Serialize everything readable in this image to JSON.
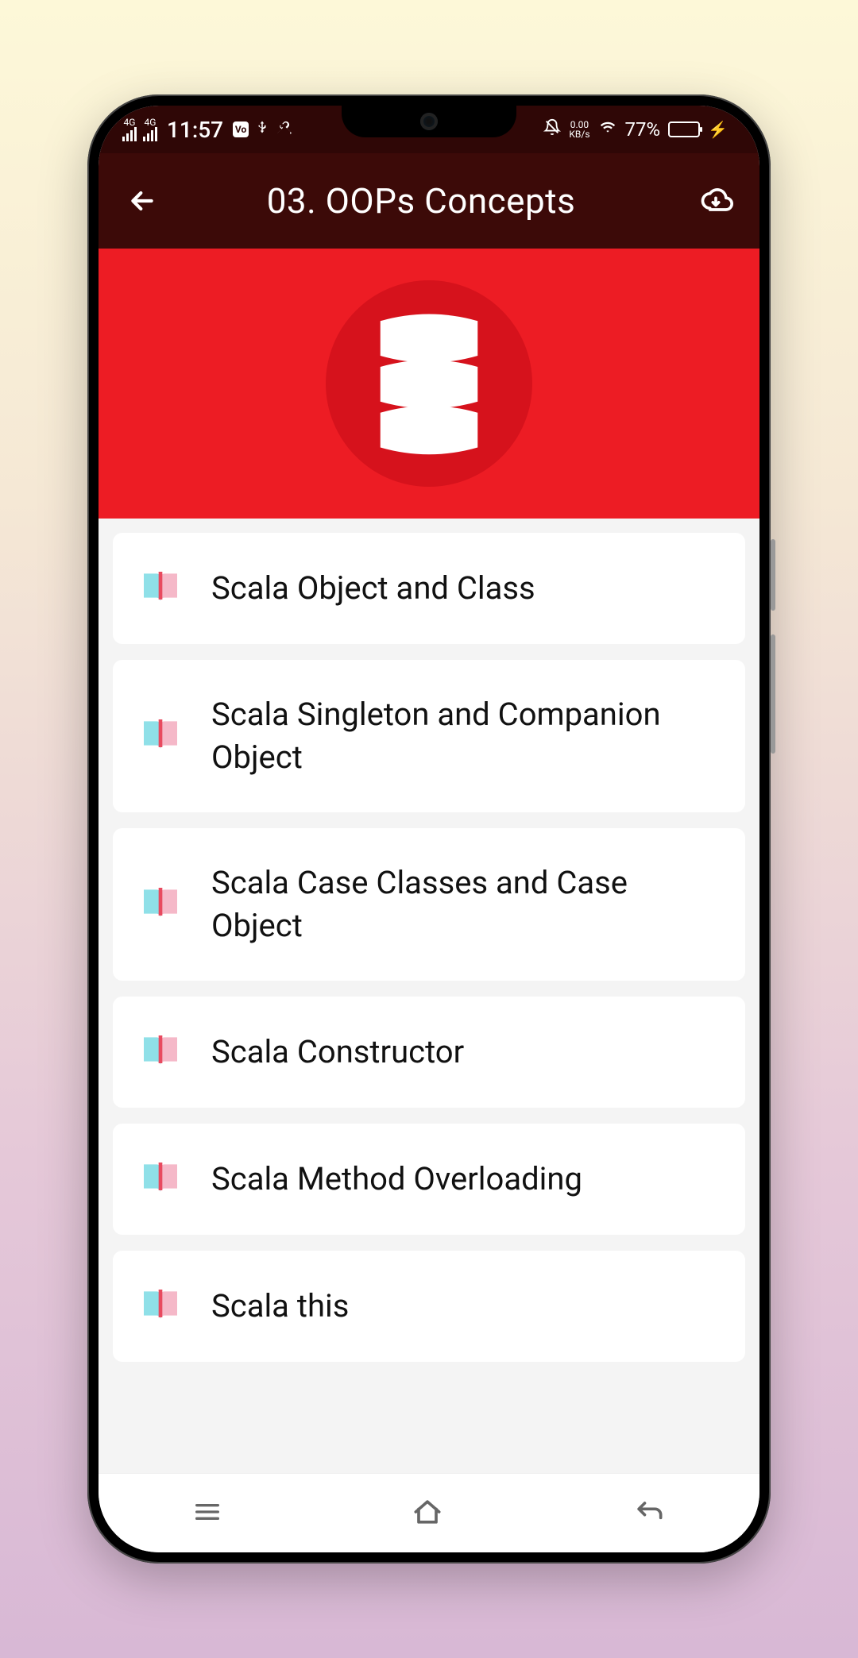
{
  "status": {
    "net_label": "4G",
    "time": "11:57",
    "vo_box": "Vo",
    "data_rate_top": "0.00",
    "data_rate_bottom": "KB/s",
    "battery_percent": "77%"
  },
  "header": {
    "title": "03. OOPs Concepts"
  },
  "topics": [
    {
      "title": "Scala Object and Class"
    },
    {
      "title": "Scala Singleton and Companion Object"
    },
    {
      "title": "Scala Case Classes and Case Object"
    },
    {
      "title": "Scala Constructor"
    },
    {
      "title": "Scala Method Overloading"
    },
    {
      "title": "Scala this"
    }
  ]
}
